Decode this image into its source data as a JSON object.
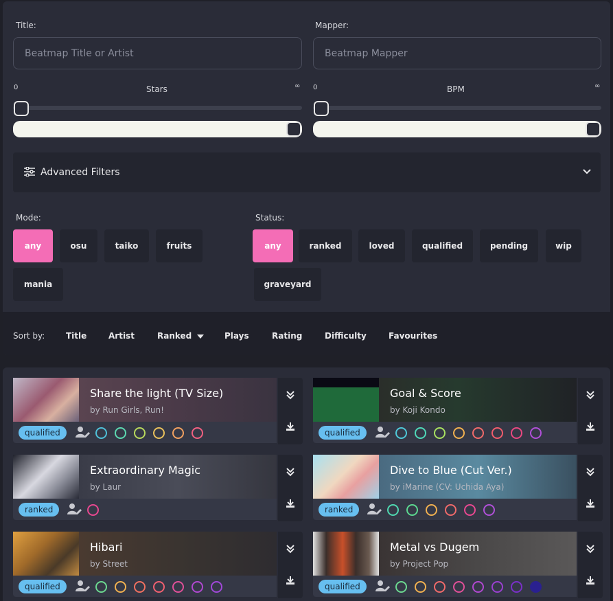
{
  "filters": {
    "title_label": "Title:",
    "title_placeholder": "Beatmap Title or Artist",
    "mapper_label": "Mapper:",
    "mapper_placeholder": "Beatmap Mapper",
    "stars": {
      "label": "Stars",
      "min_label": "0",
      "max_label": "∞",
      "range": [
        0,
        1
      ]
    },
    "bpm": {
      "label": "BPM",
      "min_label": "0",
      "max_label": "∞",
      "range": [
        0,
        1
      ]
    },
    "advanced_label": "Advanced Filters"
  },
  "mode": {
    "label": "Mode:",
    "options": [
      "any",
      "osu",
      "taiko",
      "fruits",
      "mania"
    ],
    "selected": "any"
  },
  "status": {
    "label": "Status:",
    "options": [
      "any",
      "ranked",
      "loved",
      "qualified",
      "pending",
      "wip",
      "graveyard"
    ],
    "selected": "any"
  },
  "sort": {
    "label": "Sort by:",
    "items": [
      "Title",
      "Artist",
      "Ranked",
      "Plays",
      "Rating",
      "Difficulty",
      "Favourites"
    ],
    "active": "Ranked"
  },
  "colors": {
    "accent": "#f46db6",
    "status_badge": "#67bff0"
  },
  "beatmaps": [
    {
      "title": "Share the light (TV Size)",
      "artist": "by Run Girls, Run!",
      "status": "qualified",
      "diff_icon": "waveform",
      "diffs": [
        "#4fc0d8",
        "#5cd8b0",
        "#b8d85c",
        "#e8c05c",
        "#f0a060",
        "#f06080"
      ]
    },
    {
      "title": "Goal & Score",
      "artist": "by Koji Kondo",
      "status": "qualified",
      "diff_icon": "circle",
      "diffs": [
        "#4fc8d8",
        "#4fd8b8",
        "#a8e060",
        "#f0b050",
        "#f06a6a",
        "#f05c6c",
        "#e84880",
        "#b050d8"
      ]
    },
    {
      "title": "Extraordinary Magic",
      "artist": "by Laur",
      "status": "ranked",
      "diff_icon": "circle",
      "diffs": [
        "#e84890"
      ]
    },
    {
      "title": "Dive to Blue (Cut Ver.)",
      "artist": "by iMarine (CV: Uchida Aya)",
      "status": "ranked",
      "diff_icon": "circle",
      "diffs": [
        "#4fd8b0",
        "#5cd890",
        "#f0b050",
        "#f06a6a",
        "#e84890",
        "#b050d8"
      ]
    },
    {
      "title": "Hibari",
      "artist": "by Street",
      "status": "qualified",
      "diff_icon": "circle",
      "diffs": [
        "#6cd890",
        "#f0b050",
        "#f07060",
        "#f06070",
        "#e05098",
        "#b048d0",
        "#a048d8"
      ]
    },
    {
      "title": "Metal vs Dugem",
      "artist": "by Project Pop",
      "status": "qualified",
      "diff_icon": "circle",
      "diffs": [
        "#6cd890",
        "#f0b050",
        "#f06a6a",
        "#e05098",
        "#b048d0",
        "#9a40d0",
        "#7a30c8",
        "#2a2090"
      ]
    }
  ]
}
